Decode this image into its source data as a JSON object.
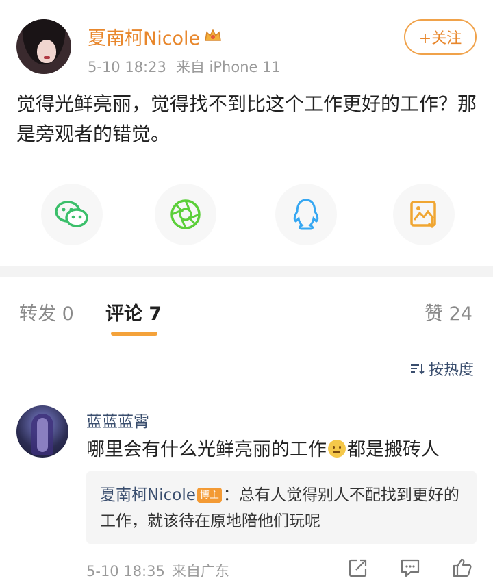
{
  "post": {
    "author": "夏南柯Nicole",
    "date": "5-10 18:23",
    "source": "来自 iPhone 11",
    "follow_label": "+关注",
    "text": "觉得光鲜亮丽，觉得找不到比这个工作更好的工作？那是旁观者的错觉。",
    "share_icons": [
      "wechat-icon",
      "moments-icon",
      "qq-icon",
      "save-image-icon"
    ]
  },
  "tabs": {
    "repost": "转发 0",
    "comment": "评论 7",
    "like": "赞 24"
  },
  "sort_label": "按热度",
  "comment": {
    "username": "蓝蓝蓝霄",
    "text_before": "哪里会有什么光鲜亮丽的工作",
    "text_after": "都是搬砖人",
    "reply": {
      "author": "夏南柯Nicole",
      "badge": "博主",
      "text": "：总有人觉得别人不配找到更好的工作，就该待在原地陪他们玩呢"
    },
    "date": "5-10 18:35",
    "location": "来自广东"
  },
  "colors": {
    "accent": "#e8872c",
    "link": "#3a4e6e",
    "muted": "#9a9a9a"
  }
}
